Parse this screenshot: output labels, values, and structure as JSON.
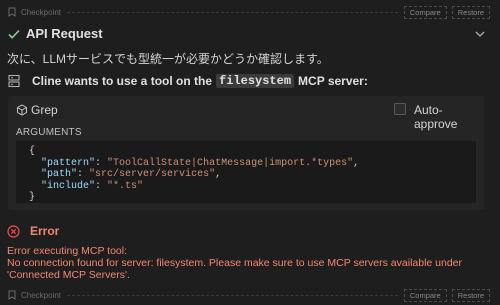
{
  "checkpoint_top": {
    "label": "Checkpoint",
    "compare": "Compare",
    "restore": "Restore"
  },
  "api_request": {
    "title": "API Request"
  },
  "message": {
    "text": "次に、LLMサービスでも型統一が必要かどうか確認します。"
  },
  "mcp": {
    "prefix": "Cline wants to use a tool on the",
    "server": "filesystem",
    "suffix": "MCP server:"
  },
  "tool": {
    "name": "Grep",
    "auto_approve": "Auto-approve",
    "arguments_label": "ARGUMENTS",
    "args": {
      "open": "{",
      "pattern_key": "\"pattern\"",
      "pattern_val": "\"ToolCallState|ChatMessage|import.*types\"",
      "path_key": "\"path\"",
      "path_val": "\"src/server/services\"",
      "include_key": "\"include\"",
      "include_val": "\"*.ts\"",
      "close": "}"
    }
  },
  "error": {
    "title": "Error",
    "line1": "Error executing MCP tool:",
    "line2": "No connection found for server: filesystem. Please make sure to use MCP servers available under 'Connected MCP Servers'."
  },
  "checkpoint_bottom": {
    "label": "Checkpoint",
    "compare": "Compare",
    "restore": "Restore"
  },
  "colors": {
    "background": "#1e1e1e",
    "success": "#89d185",
    "error": "#f48771",
    "json_key": "#9cdcfe",
    "json_string": "#ce9178"
  },
  "icons": [
    "bookmark-icon",
    "check-icon",
    "chevron-down-icon",
    "server-icon",
    "grep-tool-icon",
    "error-icon"
  ]
}
